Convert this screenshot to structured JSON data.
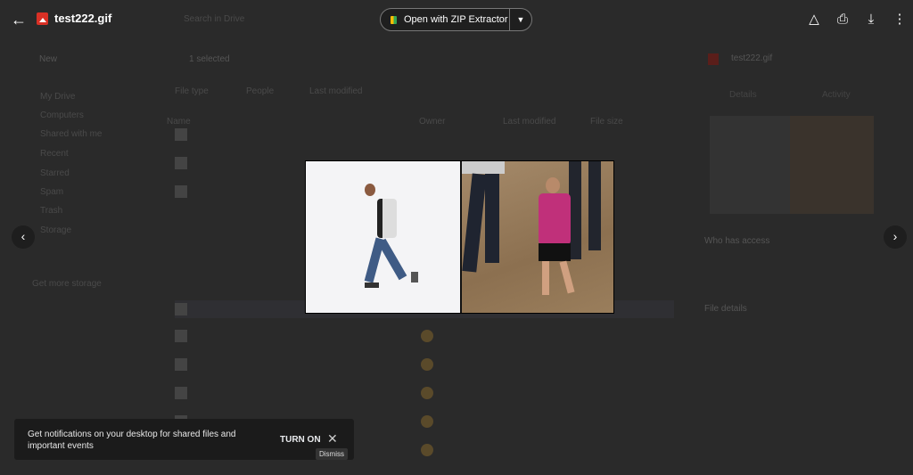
{
  "viewer": {
    "title": "test222.gif",
    "open_with": "Open with ZIP Extractor",
    "icons": [
      "back-arrow",
      "add-shortcut",
      "print",
      "download",
      "more-vert"
    ]
  },
  "background": {
    "search_placeholder": "Search in Drive",
    "new": "New",
    "selected": "1 selected",
    "filters": [
      "File type",
      "People",
      "Last modified"
    ],
    "sidebar": [
      "My Drive",
      "Computers",
      "Shared with me",
      "Recent",
      "Starred",
      "Spam",
      "Trash",
      "Storage",
      "Get more storage"
    ],
    "columns": [
      "Name",
      "Owner",
      "Last modified",
      "File size"
    ],
    "details": {
      "file": "test222.gif",
      "tabs": [
        "Details",
        "Activity"
      ],
      "who": "Who has access",
      "file_details": "File details"
    }
  },
  "toast": {
    "message": "Get notifications on your desktop for shared files and important events",
    "action": "TURN ON",
    "tooltip": "Dismiss"
  }
}
